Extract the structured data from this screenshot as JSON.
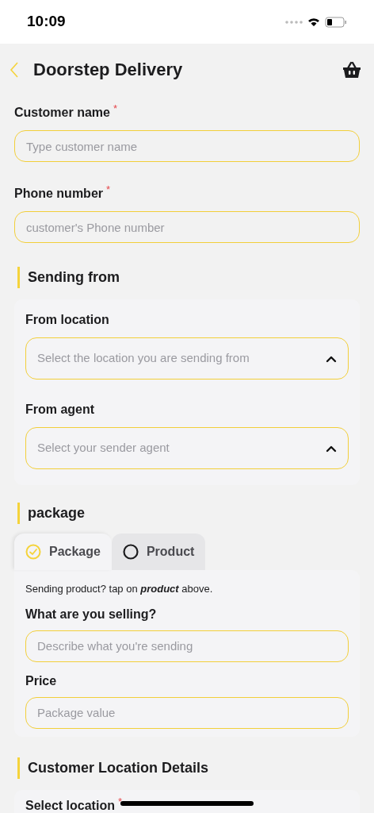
{
  "status_bar": {
    "time": "10:09"
  },
  "header": {
    "title": "Doorstep Delivery"
  },
  "fields": [
    {
      "label": "Customer name",
      "mark": "*",
      "placeholder": "Type customer name"
    },
    {
      "label": "Phone number",
      "mark": "*",
      "placeholder": "customer's Phone number"
    }
  ],
  "sections": [
    {
      "kind": "selects",
      "title": "Sending from",
      "items": [
        {
          "label": "From location",
          "placeholder": "Select the location you are sending from"
        },
        {
          "label": "From agent",
          "placeholder": "Select your sender agent"
        }
      ]
    },
    {
      "kind": "package",
      "title": "package",
      "tabs": [
        {
          "label": "Package",
          "selected": true
        },
        {
          "label": "Product",
          "selected": false
        }
      ],
      "hint": "Sending product? tap on *product* above.",
      "items": [
        {
          "label": "What are you selling?",
          "placeholder": "Describe what you're sending"
        },
        {
          "label": "Price",
          "placeholder": "Package value"
        }
      ]
    },
    {
      "kind": "location",
      "title": "Customer Location Details",
      "items": [
        {
          "label": "Select location",
          "mark": "*"
        }
      ]
    }
  ]
}
